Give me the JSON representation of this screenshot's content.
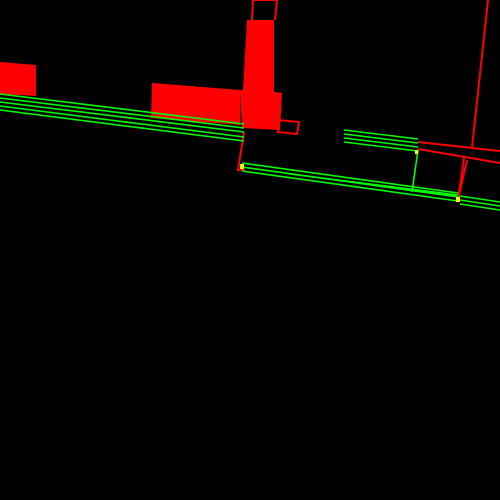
{
  "colors": {
    "background": "#000000",
    "wall": "#ff0000",
    "window": "#00ff00",
    "marker": "#ffff00"
  }
}
